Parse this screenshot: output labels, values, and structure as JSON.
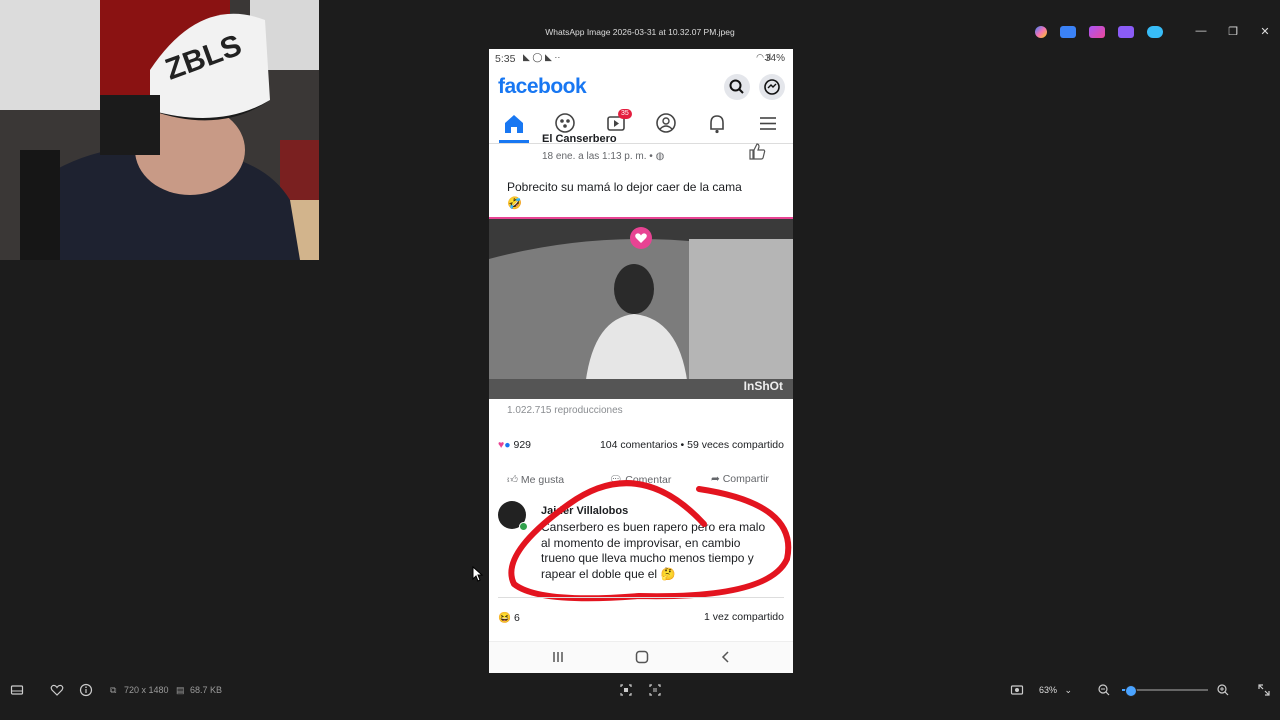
{
  "window": {
    "title": "WhatsApp Image 2026-03-31 at 10.32.07 PM.jpeg",
    "controls": [
      "—",
      "❐",
      "✕"
    ]
  },
  "phone": {
    "status_time": "5:35",
    "status_battery": "34%",
    "fb_logo": "facebook",
    "video_badge": "35",
    "post": {
      "author": "El Canserbero",
      "time": "18 ene. a las 1:13 p. m. •",
      "text": "Pobrecito su mamá lo dejor caer de la cama",
      "watermark": "InShOt",
      "views": "1.022.715 reproducciones",
      "reactions_count": "929",
      "stats": "104 comentarios • 59 veces compartido",
      "like_label": "Me gusta",
      "comment_label": "Comentar",
      "share_label": "Compartir"
    },
    "comment": {
      "author": "Jaider Villalobos",
      "text": "Canserbero es buen rapero pero era malo al momento de improvisar, en cambio trueno que lleva mucho menos tiempo y rapear el doble que el"
    },
    "next_post": {
      "reactions_count": "6",
      "shares": "1 vez compartido"
    }
  },
  "viewer": {
    "dimensions": "720 x 1480",
    "filesize": "68.7 KB",
    "zoom": "63%",
    "zoom_slider_value": 0.05
  },
  "colors": {
    "fb_blue": "#1877f2",
    "annotation_red": "#e3141f",
    "badge_red": "#e41e3f"
  }
}
